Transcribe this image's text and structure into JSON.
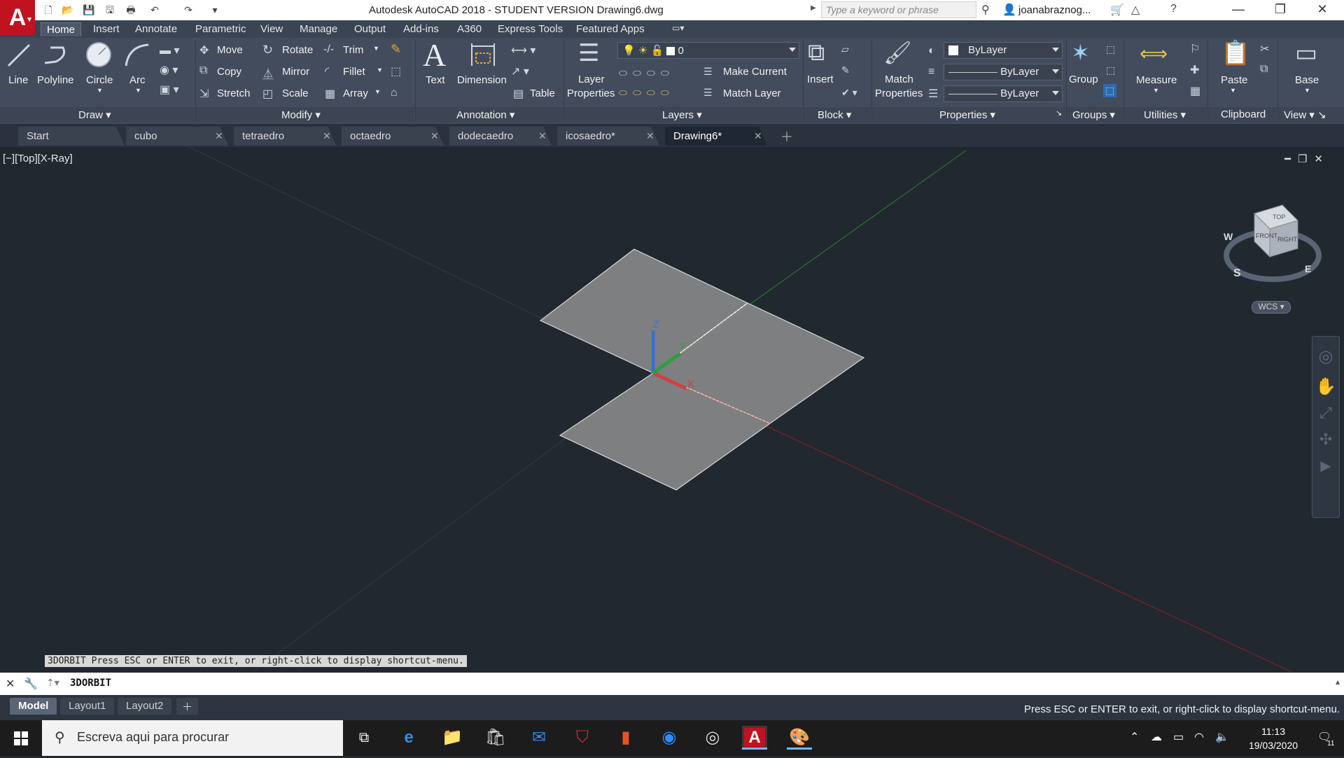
{
  "window": {
    "title": "Autodesk AutoCAD 2018 - STUDENT VERSION    Drawing6.dwg",
    "search_placeholder": "Type a keyword or phrase",
    "user": "joanabraznog...",
    "app_logo": "A"
  },
  "ribbon_tabs": [
    "Home",
    "Insert",
    "Annotate",
    "Parametric",
    "View",
    "Manage",
    "Output",
    "Add-ins",
    "A360",
    "Express Tools",
    "Featured Apps"
  ],
  "ribbon": {
    "draw": {
      "title": "Draw",
      "line": "Line",
      "polyline": "Polyline",
      "circle": "Circle",
      "arc": "Arc"
    },
    "modify": {
      "title": "Modify",
      "move": "Move",
      "rotate": "Rotate",
      "trim": "Trim",
      "copy": "Copy",
      "mirror": "Mirror",
      "fillet": "Fillet",
      "stretch": "Stretch",
      "scale": "Scale",
      "array": "Array"
    },
    "annotation": {
      "title": "Annotation",
      "text": "Text",
      "dimension": "Dimension",
      "table": "Table"
    },
    "layers": {
      "title": "Layers",
      "layer_properties_1": "Layer",
      "layer_properties_2": "Properties",
      "current_layer": "0",
      "make_current": "Make Current",
      "match_layer": "Match Layer"
    },
    "block": {
      "title": "Block",
      "insert": "Insert"
    },
    "properties": {
      "title": "Properties",
      "match_1": "Match",
      "match_2": "Properties",
      "color": "ByLayer",
      "linetype": "ByLayer",
      "lineweight": "ByLayer"
    },
    "groups": {
      "title": "Groups",
      "group": "Group"
    },
    "utilities": {
      "title": "Utilities",
      "measure": "Measure"
    },
    "clipboard": {
      "title": "Clipboard",
      "paste": "Paste"
    },
    "view": {
      "title": "View",
      "base": "Base"
    }
  },
  "file_tabs": [
    "Start",
    "cubo",
    "tetraedro",
    "octaedro",
    "dodecaedro",
    "icosaedro*",
    "Drawing6*"
  ],
  "viewport": {
    "label": "[−][Top][X-Ray]",
    "viewcube_wcs": "WCS",
    "viewcube_faces": {
      "top": "TOP",
      "front": "FRONT",
      "right": "RIGHT"
    },
    "compass": {
      "w": "W",
      "s": "S",
      "e": "E"
    },
    "axis_labels": {
      "x": "X",
      "y": "Y",
      "z": "Z"
    },
    "command_hint": "3DORBIT Press ESC or ENTER to exit, or right-click to display shortcut-menu."
  },
  "command_line": {
    "text": "3DORBIT"
  },
  "layout_tabs": [
    "Model",
    "Layout1",
    "Layout2"
  ],
  "status_message": "Press ESC or ENTER to exit, or right-click to display shortcut-menu.",
  "taskbar": {
    "search_placeholder": "Escreva aqui para procurar",
    "time": "11:13",
    "date": "19/03/2020",
    "notification_count": "11"
  },
  "colors": {
    "accent_red": "#c1121f",
    "viewport_bg": "#212830",
    "ribbon_bg": "#434c5c",
    "plane_fill": "#8e8e8e"
  }
}
